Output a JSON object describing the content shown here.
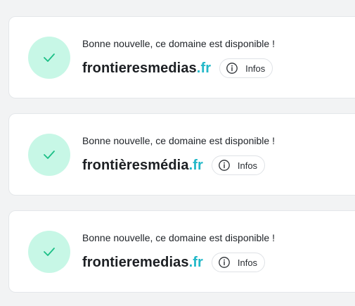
{
  "results": [
    {
      "message": "Bonne nouvelle, ce domaine est disponible !",
      "domain_name": "frontieresmedias",
      "tld": ".fr",
      "infos_label": "Infos",
      "status_icon": "check-icon"
    },
    {
      "message": "Bonne nouvelle, ce domaine est disponible !",
      "domain_name": "frontièresmédia",
      "tld": ".fr",
      "infos_label": "Infos",
      "status_icon": "check-icon"
    },
    {
      "message": "Bonne nouvelle, ce domaine est disponible !",
      "domain_name": "frontieremedias",
      "tld": ".fr",
      "infos_label": "Infos",
      "status_icon": "check-icon"
    }
  ],
  "colors": {
    "page_background": "#f2f3f4",
    "card_background": "#ffffff",
    "success_circle": "#c7f7e6",
    "success_check": "#1bbf86",
    "tld_accent": "#22b8c8"
  }
}
